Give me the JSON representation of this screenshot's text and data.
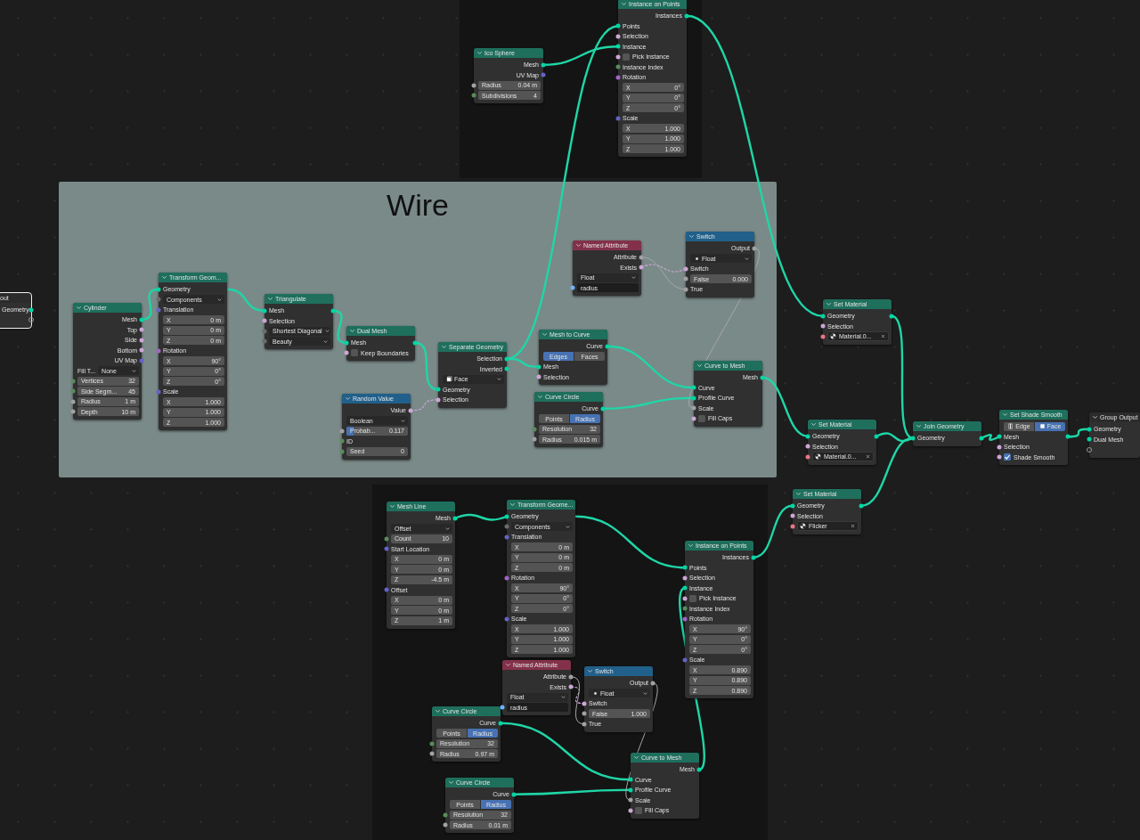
{
  "frames": [
    {
      "kind": "dark"
    },
    {
      "kind": "light",
      "label": "Wire"
    },
    {
      "kind": "dark"
    }
  ],
  "nodes": [
    {
      "title": "Ico Sphere",
      "kind": "geometry",
      "selected": false,
      "rows": [
        {
          "kind": "out",
          "label": "Mesh",
          "color": "#00d6a3"
        },
        {
          "kind": "out",
          "label": "UV Map",
          "color": "#6363c7"
        },
        {
          "kind": "field",
          "label": "Radius",
          "value": "0.04 m",
          "color": "#a1a1a1"
        },
        {
          "kind": "field",
          "label": "Subdivisions",
          "value": "4",
          "color": "#598c5c"
        }
      ]
    },
    {
      "title": "Instance on Points",
      "kind": "geometry",
      "selected": false,
      "rows": [
        {
          "kind": "out",
          "label": "Instances",
          "color": "#00d6a3"
        },
        {
          "kind": "in",
          "label": "Points",
          "color": "#00d6a3"
        },
        {
          "kind": "in",
          "label": "Selection",
          "color": "#cca6d6"
        },
        {
          "kind": "in",
          "label": "Instance",
          "color": "#00d6a3"
        },
        {
          "kind": "check",
          "label": "Pick Instance",
          "checked": false,
          "color": "#cca6d6"
        },
        {
          "kind": "in",
          "label": "Instance Index",
          "color": "#598c5c"
        },
        {
          "kind": "in",
          "label": "Rotation",
          "color": "#a363c7"
        },
        {
          "kind": "field",
          "label": "X",
          "value": "0°"
        },
        {
          "kind": "field",
          "label": "Y",
          "value": "0°"
        },
        {
          "kind": "field",
          "label": "Z",
          "value": "0°"
        },
        {
          "kind": "in",
          "label": "Scale",
          "color": "#6363c7"
        },
        {
          "kind": "field",
          "label": "X",
          "value": "1.000"
        },
        {
          "kind": "field",
          "label": "Y",
          "value": "1.000"
        },
        {
          "kind": "field",
          "label": "Z",
          "value": "1.000"
        }
      ]
    },
    {
      "title": "out",
      "kind": "group",
      "selected": true,
      "rows": [
        {
          "kind": "out",
          "label": "Geometry",
          "color": "#00d6a3"
        },
        {
          "kind": "blank-out"
        }
      ]
    },
    {
      "title": "Cylinder",
      "kind": "geometry",
      "selected": false,
      "rows": [
        {
          "kind": "out",
          "label": "Mesh",
          "color": "#00d6a3"
        },
        {
          "kind": "out",
          "label": "Top",
          "color": "#cca6d6"
        },
        {
          "kind": "out",
          "label": "Side",
          "color": "#cca6d6"
        },
        {
          "kind": "out",
          "label": "Bottom",
          "color": "#cca6d6"
        },
        {
          "kind": "out",
          "label": "UV Map",
          "color": "#6363c7"
        },
        {
          "kind": "dropdown",
          "label": "Fill T...",
          "value": "None"
        },
        {
          "kind": "field",
          "label": "Vertices",
          "value": "32",
          "color": "#598c5c"
        },
        {
          "kind": "field",
          "label": "Side Segm...",
          "value": "45",
          "color": "#598c5c"
        },
        {
          "kind": "field",
          "label": "Radius",
          "value": "1 m",
          "color": "#a1a1a1"
        },
        {
          "kind": "field",
          "label": "Depth",
          "value": "10 m",
          "color": "#a1a1a1"
        }
      ]
    },
    {
      "title": "Transform Geom...",
      "kind": "geometry",
      "selected": false,
      "rows": [
        {
          "kind": "in",
          "label": "Geometry",
          "color": "#00d6a3"
        },
        {
          "kind": "dropdown",
          "value": "Components",
          "color": "#6b6b6b"
        },
        {
          "kind": "in",
          "label": "Translation",
          "color": "#6363c7"
        },
        {
          "kind": "field",
          "label": "X",
          "value": "0 m"
        },
        {
          "kind": "field",
          "label": "Y",
          "value": "0 m"
        },
        {
          "kind": "field",
          "label": "Z",
          "value": "0 m"
        },
        {
          "kind": "in",
          "label": "Rotation",
          "color": "#a363c7"
        },
        {
          "kind": "field",
          "label": "X",
          "value": "90°"
        },
        {
          "kind": "field",
          "label": "Y",
          "value": "0°"
        },
        {
          "kind": "field",
          "label": "Z",
          "value": "0°"
        },
        {
          "kind": "in",
          "label": "Scale",
          "color": "#6363c7"
        },
        {
          "kind": "field",
          "label": "X",
          "value": "1.000"
        },
        {
          "kind": "field",
          "label": "Y",
          "value": "1.000"
        },
        {
          "kind": "field",
          "label": "Z",
          "value": "1.000"
        }
      ]
    },
    {
      "title": "Triangulate",
      "kind": "geometry",
      "selected": false,
      "rows": [
        {
          "kind": "through",
          "label": "Mesh",
          "color": "#00d6a3"
        },
        {
          "kind": "in",
          "label": "Selection",
          "color": "#cca6d6"
        },
        {
          "kind": "dropdown",
          "value": "Shortest Diagonal",
          "color": "#6b6b6b"
        },
        {
          "kind": "dropdown",
          "value": "Beauty",
          "color": "#6b6b6b"
        }
      ]
    },
    {
      "title": "Dual Mesh",
      "kind": "geometry",
      "selected": false,
      "rows": [
        {
          "kind": "through",
          "label": "Mesh",
          "color": "#00d6a3"
        },
        {
          "kind": "check",
          "label": "Keep Boundaries",
          "checked": false,
          "color": "#cca6d6"
        }
      ]
    },
    {
      "title": "Random Value",
      "kind": "utility",
      "selected": false,
      "rows": [
        {
          "kind": "out",
          "label": "Value",
          "color": "#cca6d6"
        },
        {
          "kind": "dropdown",
          "value": "Boolean"
        },
        {
          "kind": "slider",
          "label": "Probab...",
          "value": "0.117",
          "level": 0.117,
          "color": "#a1a1a1"
        },
        {
          "kind": "in",
          "label": "ID",
          "color": "#598c5c"
        },
        {
          "kind": "field",
          "label": "Seed",
          "value": "0",
          "color": "#598c5c"
        }
      ]
    },
    {
      "title": "Separate Geometry",
      "kind": "geometry",
      "selected": false,
      "rows": [
        {
          "kind": "out",
          "label": "Selection",
          "color": "#00d6a3"
        },
        {
          "kind": "out",
          "label": "Inverted",
          "color": "#00d6a3"
        },
        {
          "kind": "domain-dropdown",
          "value": "Face"
        },
        {
          "kind": "in",
          "label": "Geometry",
          "color": "#00d6a3"
        },
        {
          "kind": "in",
          "label": "Selection",
          "color": "#cca6d6"
        }
      ]
    },
    {
      "title": "Named Attribute",
      "kind": "attribute",
      "selected": false,
      "rows": [
        {
          "kind": "out",
          "label": "Attribute",
          "color": "#a1a1a1"
        },
        {
          "kind": "out",
          "label": "Exists",
          "color": "#cca6d6"
        },
        {
          "kind": "dropdown",
          "value": "Float"
        },
        {
          "kind": "text",
          "value": "radius",
          "color": "#70b2ff"
        }
      ]
    },
    {
      "title": "Switch",
      "kind": "utility",
      "selected": false,
      "rows": [
        {
          "kind": "out",
          "label": "Output",
          "color": "#a1a1a1"
        },
        {
          "kind": "type-dropdown",
          "value": "Float"
        },
        {
          "kind": "in",
          "label": "Switch",
          "color": "#cca6d6"
        },
        {
          "kind": "field",
          "label": "False",
          "value": "0.000",
          "color": "#a1a1a1"
        },
        {
          "kind": "in",
          "label": "True",
          "color": "#a1a1a1"
        }
      ]
    },
    {
      "title": "Mesh to Curve",
      "kind": "geometry",
      "selected": false,
      "rows": [
        {
          "kind": "out",
          "label": "Curve",
          "color": "#00d6a3"
        },
        {
          "kind": "toggle",
          "options": [
            {
              "label": "Edges",
              "selected": true
            },
            {
              "label": "Faces",
              "selected": false
            }
          ]
        },
        {
          "kind": "in",
          "label": "Mesh",
          "color": "#00d6a3"
        },
        {
          "kind": "in",
          "label": "Selection",
          "color": "#cca6d6"
        }
      ]
    },
    {
      "title": "Curve Circle",
      "kind": "geometry",
      "selected": false,
      "rows": [
        {
          "kind": "out",
          "label": "Curve",
          "color": "#00d6a3"
        },
        {
          "kind": "toggle",
          "options": [
            {
              "label": "Points",
              "selected": false
            },
            {
              "label": "Radius",
              "selected": true
            }
          ]
        },
        {
          "kind": "field",
          "label": "Resolution",
          "value": "32",
          "color": "#598c5c"
        },
        {
          "kind": "field",
          "label": "Radius",
          "value": "0.015 m",
          "color": "#a1a1a1"
        }
      ]
    },
    {
      "title": "Curve to Mesh",
      "kind": "geometry",
      "selected": false,
      "rows": [
        {
          "kind": "out",
          "label": "Mesh",
          "color": "#00d6a3"
        },
        {
          "kind": "in",
          "label": "Curve",
          "color": "#00d6a3"
        },
        {
          "kind": "in",
          "label": "Profile Curve",
          "color": "#00d6a3"
        },
        {
          "kind": "in",
          "label": "Scale",
          "color": "#a1a1a1"
        },
        {
          "kind": "check",
          "label": "Fill Caps",
          "checked": false,
          "color": "#cca6d6"
        }
      ]
    },
    {
      "title": "Set Material",
      "kind": "geometry",
      "selected": false,
      "rows": [
        {
          "kind": "through",
          "label": "Geometry",
          "color": "#00d6a3"
        },
        {
          "kind": "in",
          "label": "Selection",
          "color": "#cca6d6"
        },
        {
          "kind": "material",
          "value": "Material.0...",
          "color": "#eb7582"
        }
      ]
    },
    {
      "title": "Set Material",
      "kind": "geometry",
      "selected": false,
      "rows": [
        {
          "kind": "through",
          "label": "Geometry",
          "color": "#00d6a3"
        },
        {
          "kind": "in",
          "label": "Selection",
          "color": "#cca6d6"
        },
        {
          "kind": "material",
          "value": "Material.0...",
          "color": "#eb7582"
        }
      ]
    },
    {
      "title": "Join Geometry",
      "kind": "geometry",
      "selected": false,
      "rows": [
        {
          "kind": "through",
          "label": "Geometry",
          "color": "#00d6a3"
        }
      ]
    },
    {
      "title": "Set Shade Smooth",
      "kind": "geometry",
      "selected": false,
      "rows": [
        {
          "kind": "domain-toggle",
          "options": [
            {
              "label": "Edge",
              "selected": false
            },
            {
              "label": "Face",
              "selected": true
            }
          ]
        },
        {
          "kind": "through",
          "label": "Mesh",
          "color": "#00d6a3"
        },
        {
          "kind": "in",
          "label": "Selection",
          "color": "#cca6d6"
        },
        {
          "kind": "check",
          "label": "Shade Smooth",
          "checked": true,
          "color": "#cca6d6"
        }
      ]
    },
    {
      "title": "Group Output",
      "kind": "group",
      "selected": false,
      "rows": [
        {
          "kind": "in",
          "label": "Geometry",
          "color": "#00d6a3"
        },
        {
          "kind": "in",
          "label": "Dual Mesh",
          "color": "#00d6a3"
        },
        {
          "kind": "blank-in"
        }
      ]
    },
    {
      "title": "Set Material",
      "kind": "geometry",
      "selected": false,
      "rows": [
        {
          "kind": "through",
          "label": "Geometry",
          "color": "#00d6a3"
        },
        {
          "kind": "in",
          "label": "Selection",
          "color": "#cca6d6"
        },
        {
          "kind": "material",
          "value": "Flicker",
          "color": "#eb7582"
        }
      ]
    },
    {
      "title": "Mesh Line",
      "kind": "geometry",
      "selected": false,
      "rows": [
        {
          "kind": "out",
          "label": "Mesh",
          "color": "#00d6a3"
        },
        {
          "kind": "dropdown",
          "value": "Offset"
        },
        {
          "kind": "field",
          "label": "Count",
          "value": "10",
          "color": "#598c5c"
        },
        {
          "kind": "in",
          "label": "Start Location",
          "color": "#6363c7"
        },
        {
          "kind": "field",
          "label": "X",
          "value": "0 m"
        },
        {
          "kind": "field",
          "label": "Y",
          "value": "0 m"
        },
        {
          "kind": "field",
          "label": "Z",
          "value": "-4.5 m"
        },
        {
          "kind": "in",
          "label": "Offset",
          "color": "#6363c7"
        },
        {
          "kind": "field",
          "label": "X",
          "value": "0 m"
        },
        {
          "kind": "field",
          "label": "Y",
          "value": "0 m"
        },
        {
          "kind": "field",
          "label": "Z",
          "value": "1 m"
        }
      ]
    },
    {
      "title": "Transform Geome...",
      "kind": "geometry",
      "selected": false,
      "rows": [
        {
          "kind": "in",
          "label": "Geometry",
          "color": "#00d6a3"
        },
        {
          "kind": "dropdown",
          "value": "Components",
          "color": "#6b6b6b"
        },
        {
          "kind": "in",
          "label": "Translation",
          "color": "#6363c7"
        },
        {
          "kind": "field",
          "label": "X",
          "value": "0 m"
        },
        {
          "kind": "field",
          "label": "Y",
          "value": "0 m"
        },
        {
          "kind": "field",
          "label": "Z",
          "value": "0 m"
        },
        {
          "kind": "in",
          "label": "Rotation",
          "color": "#a363c7"
        },
        {
          "kind": "field",
          "label": "X",
          "value": "90°"
        },
        {
          "kind": "field",
          "label": "Y",
          "value": "0°"
        },
        {
          "kind": "field",
          "label": "Z",
          "value": "0°"
        },
        {
          "kind": "in",
          "label": "Scale",
          "color": "#6363c7"
        },
        {
          "kind": "field",
          "label": "X",
          "value": "1.000"
        },
        {
          "kind": "field",
          "label": "Y",
          "value": "1.000"
        },
        {
          "kind": "field",
          "label": "Z",
          "value": "1.000"
        }
      ]
    },
    {
      "title": "Instance on Points",
      "kind": "geometry",
      "selected": false,
      "rows": [
        {
          "kind": "out",
          "label": "Instances",
          "color": "#00d6a3"
        },
        {
          "kind": "in",
          "label": "Points",
          "color": "#00d6a3"
        },
        {
          "kind": "in",
          "label": "Selection",
          "color": "#cca6d6"
        },
        {
          "kind": "in",
          "label": "Instance",
          "color": "#00d6a3"
        },
        {
          "kind": "check",
          "label": "Pick Instance",
          "checked": false,
          "color": "#cca6d6"
        },
        {
          "kind": "in",
          "label": "Instance Index",
          "color": "#598c5c"
        },
        {
          "kind": "in",
          "label": "Rotation",
          "color": "#a363c7"
        },
        {
          "kind": "field",
          "label": "X",
          "value": "90°"
        },
        {
          "kind": "field",
          "label": "Y",
          "value": "0°"
        },
        {
          "kind": "field",
          "label": "Z",
          "value": "0°"
        },
        {
          "kind": "in",
          "label": "Scale",
          "color": "#6363c7"
        },
        {
          "kind": "field",
          "label": "X",
          "value": "0.890"
        },
        {
          "kind": "field",
          "label": "Y",
          "value": "0.890"
        },
        {
          "kind": "field",
          "label": "Z",
          "value": "0.890"
        }
      ]
    },
    {
      "title": "Named Attribute",
      "kind": "attribute",
      "selected": false,
      "rows": [
        {
          "kind": "out",
          "label": "Attribute",
          "color": "#a1a1a1"
        },
        {
          "kind": "out",
          "label": "Exists",
          "color": "#cca6d6"
        },
        {
          "kind": "dropdown",
          "value": "Float"
        },
        {
          "kind": "text",
          "value": "radius",
          "color": "#70b2ff"
        }
      ]
    },
    {
      "title": "Switch",
      "kind": "utility",
      "selected": false,
      "rows": [
        {
          "kind": "out",
          "label": "Output",
          "color": "#a1a1a1"
        },
        {
          "kind": "type-dropdown",
          "value": "Float"
        },
        {
          "kind": "in",
          "label": "Switch",
          "color": "#cca6d6"
        },
        {
          "kind": "field",
          "label": "False",
          "value": "1.000",
          "color": "#a1a1a1"
        },
        {
          "kind": "in",
          "label": "True",
          "color": "#a1a1a1"
        }
      ]
    },
    {
      "title": "Curve Circle",
      "kind": "geometry",
      "selected": false,
      "rows": [
        {
          "kind": "out",
          "label": "Curve",
          "color": "#00d6a3"
        },
        {
          "kind": "toggle",
          "options": [
            {
              "label": "Points",
              "selected": false
            },
            {
              "label": "Radius",
              "selected": true
            }
          ]
        },
        {
          "kind": "field",
          "label": "Resolution",
          "value": "32",
          "color": "#598c5c"
        },
        {
          "kind": "field",
          "label": "Radius",
          "value": "0.97 m",
          "color": "#a1a1a1"
        }
      ]
    },
    {
      "title": "Curve to Mesh",
      "kind": "geometry",
      "selected": false,
      "rows": [
        {
          "kind": "out",
          "label": "Mesh",
          "color": "#00d6a3"
        },
        {
          "kind": "in",
          "label": "Curve",
          "color": "#00d6a3"
        },
        {
          "kind": "in",
          "label": "Profile Curve",
          "color": "#00d6a3"
        },
        {
          "kind": "in",
          "label": "Scale",
          "color": "#a1a1a1"
        },
        {
          "kind": "check",
          "label": "Fill Caps",
          "checked": false,
          "color": "#cca6d6"
        }
      ]
    },
    {
      "title": "Curve Circle",
      "kind": "geometry",
      "selected": false,
      "rows": [
        {
          "kind": "out",
          "label": "Curve",
          "color": "#00d6a3"
        },
        {
          "kind": "toggle",
          "options": [
            {
              "label": "Points",
              "selected": false
            },
            {
              "label": "Radius",
              "selected": true
            }
          ]
        },
        {
          "kind": "field",
          "label": "Resolution",
          "value": "32",
          "color": "#598c5c"
        },
        {
          "kind": "field",
          "label": "Radius",
          "value": "0.01 m",
          "color": "#a1a1a1"
        }
      ]
    }
  ]
}
